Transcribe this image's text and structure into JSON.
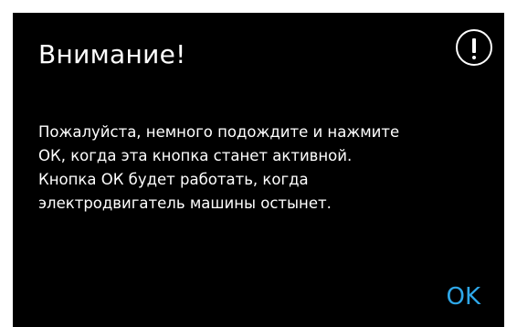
{
  "dialog": {
    "title": "Внимание!",
    "icon": "exclamation-circle-icon",
    "message_lines": [
      "Пожалуйста, немного подождите и нажмите",
      "ОК, когда эта кнопка станет активной.",
      "Кнопка ОК будет работать, когда",
      "электродвигатель машины остынет."
    ],
    "ok_label": "OK"
  },
  "colors": {
    "dialog_background": "#000000",
    "text": "#ffffff",
    "accent": "#2ea7e8",
    "page_background": "#ffffff"
  }
}
